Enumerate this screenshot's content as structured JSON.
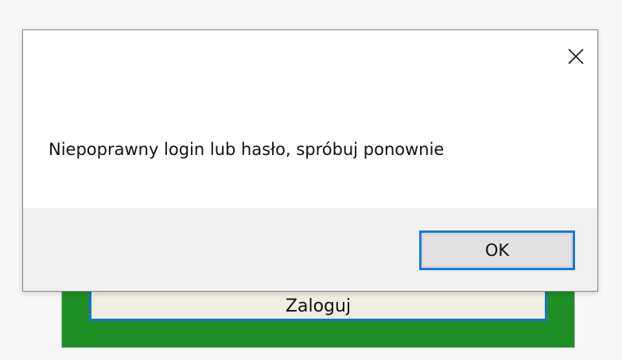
{
  "background_app": {
    "login_button_label": "Zaloguj",
    "panel_color": "#1f8e24",
    "button_border_color": "#1a6fd4"
  },
  "dialog": {
    "message": "Niepoprawny login lub hasło, spróbuj ponownie",
    "ok_label": "OK",
    "close_icon": "close-icon",
    "accent_color": "#1979d9"
  }
}
